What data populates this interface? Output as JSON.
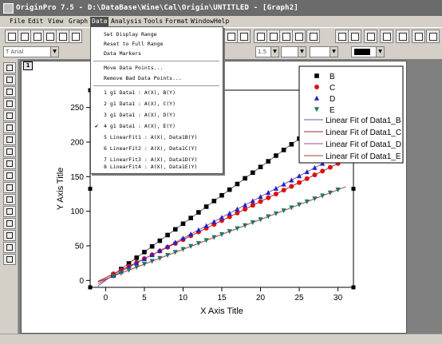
{
  "window": {
    "title": "OriginPro 7.5 - D:\\DataBase\\Wine\\Cal\\Origin\\UNTITLED - [Graph2]"
  },
  "menubar": {
    "items": [
      "File",
      "Edit",
      "View",
      "Graph",
      "Data",
      "Analysis",
      "Tools",
      "Format",
      "Window",
      "Help"
    ],
    "active": "Data"
  },
  "toolbar2": {
    "font_combo": "T  Arial",
    "size_combo": "1.5"
  },
  "graph": {
    "layer_label": "1"
  },
  "data_menu": {
    "items": [
      "Set Display Range",
      "Reset to Full Range",
      "Data Markers",
      "Move Data Points...",
      "Remove Bad Data Points...",
      "1 g1 Data1 : A(X), B(Y)",
      "2 g1 Data1 : A(X), C(Y)",
      "3 g1 Data1 : A(X), D(Y)",
      "4 g1 Data1 : A(X), E(Y)",
      "5 LinearFit1 : A(X), Data1B(Y)",
      "6 LinearFit2 : A(X), Data1C(Y)",
      "7 LinearFit3 : A(X), Data1D(Y)",
      "8 LinearFit4 : A(X), Data1E(Y)"
    ],
    "checked_item": "4 g1 Data1 : A(X), E(Y)"
  },
  "chart_data": {
    "type": "scatter",
    "xlabel": "X Axis Title",
    "ylabel": "Y Axis Title",
    "xlim": [
      -2,
      32
    ],
    "ylim": [
      -10,
      275
    ],
    "xticks": [
      0,
      5,
      10,
      15,
      20,
      25,
      30
    ],
    "yticks": [
      0,
      50,
      100,
      150,
      200,
      250
    ],
    "x": [
      1,
      2,
      3,
      4,
      5,
      6,
      7,
      8,
      9,
      10,
      11,
      12,
      13,
      14,
      15,
      16,
      17,
      18,
      19,
      20,
      21,
      22,
      23,
      24,
      25,
      26,
      27,
      28,
      29,
      30
    ],
    "series": [
      {
        "name": "B",
        "marker": "square",
        "color": "#000000",
        "slope": 8.2,
        "intercept": 0
      },
      {
        "name": "C",
        "marker": "circle",
        "color": "#dd1111",
        "slope": 5.5,
        "intercept": 4
      },
      {
        "name": "D",
        "marker": "triangle-up",
        "color": "#2222cc",
        "slope": 6.0,
        "intercept": 1
      },
      {
        "name": "E",
        "marker": "triangle-down",
        "color": "#227766",
        "slope": 4.3,
        "intercept": 2
      }
    ],
    "fits": [
      {
        "name": "Linear Fit of Data1_B",
        "color": "#6a5a9a"
      },
      {
        "name": "Linear Fit of Data1_C",
        "color": "#aa2233"
      },
      {
        "name": "Linear Fit of Data1_D",
        "color": "#8a5a9a"
      },
      {
        "name": "Linear Fit of Data1_E",
        "color": "#aa4433"
      }
    ],
    "legend": "top-right"
  }
}
